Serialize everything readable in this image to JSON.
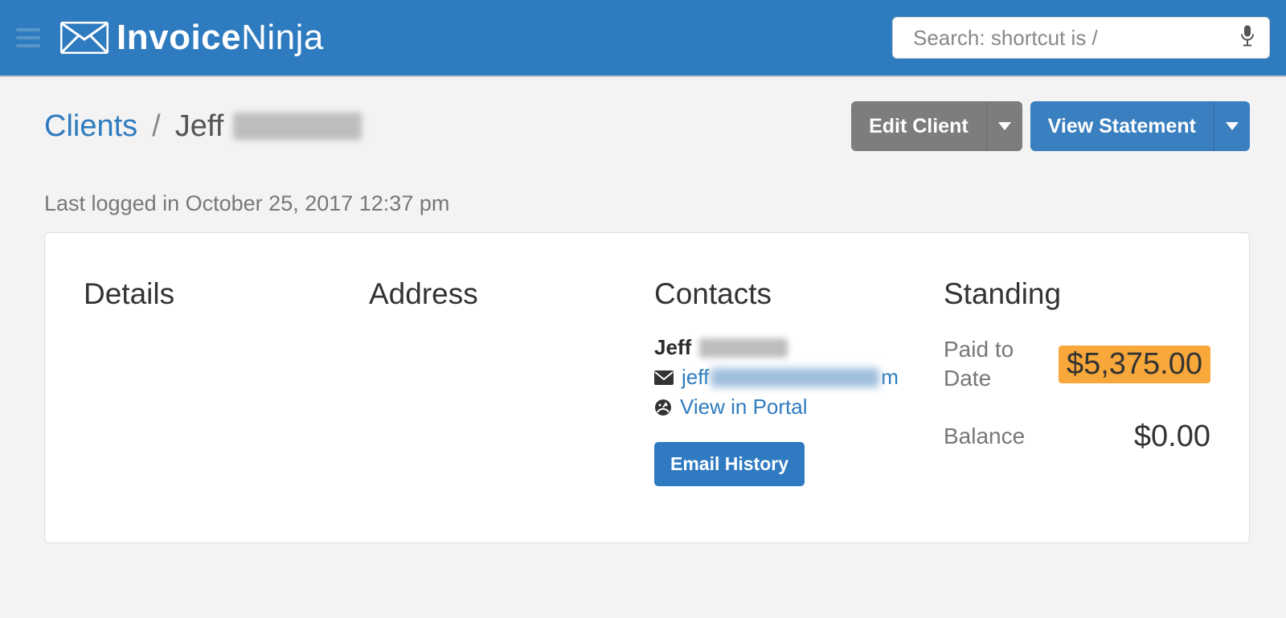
{
  "app": {
    "brand_bold": "Invoice",
    "brand_thin": "Ninja"
  },
  "search": {
    "placeholder": "Search: shortcut is /"
  },
  "breadcrumb": {
    "root": "Clients",
    "sep": "/",
    "current_first": "Jeff"
  },
  "actions": {
    "edit_client": "Edit Client",
    "view_statement": "View Statement"
  },
  "last_login_line": "Last logged in October 25, 2017 12:37 pm",
  "panel": {
    "details_heading": "Details",
    "address_heading": "Address",
    "contacts_heading": "Contacts",
    "standing_heading": "Standing",
    "contact": {
      "first_name": "Jeff",
      "email_prefix": "jeff",
      "email_suffix": "m",
      "view_in_portal": "View in Portal",
      "email_history": "Email History"
    },
    "standing": {
      "paid_to_date_label": "Paid to Date",
      "paid_to_date_value": "$5,375.00",
      "balance_label": "Balance",
      "balance_value": "$0.00"
    }
  }
}
